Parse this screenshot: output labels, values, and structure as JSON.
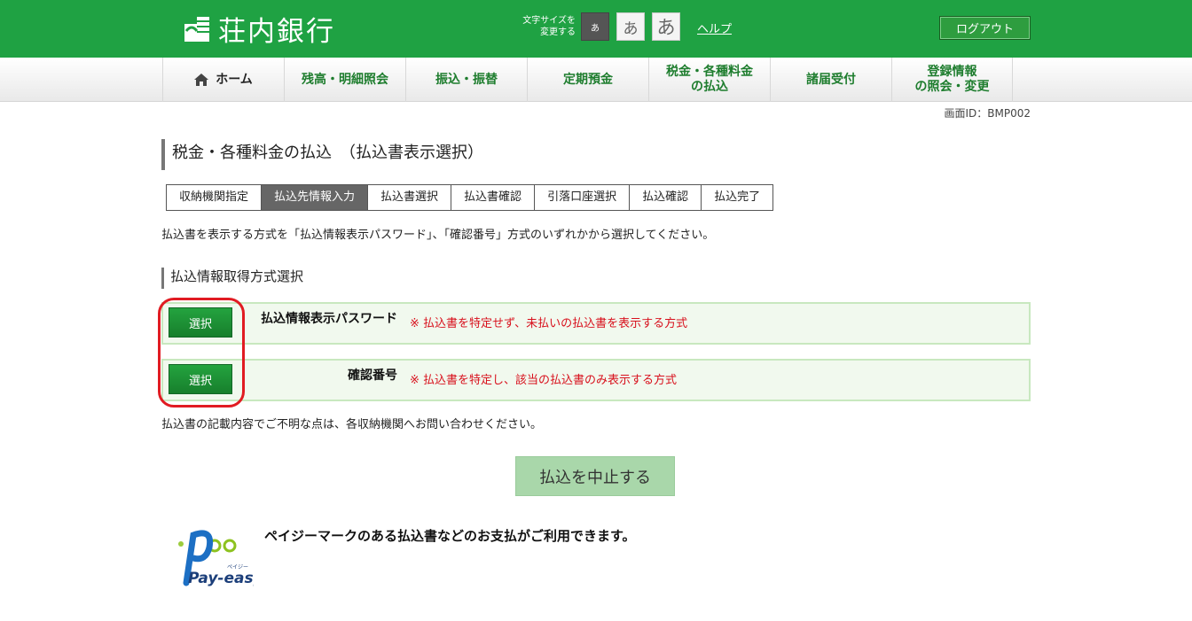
{
  "header": {
    "bank_name": "荘内銀行",
    "font_size_label_line1": "文字サイズを",
    "font_size_label_line2": "変更する",
    "font_size_small": "あ",
    "font_size_medium": "あ",
    "font_size_large": "あ",
    "help_label": "ヘルプ",
    "logout_label": "ログアウト",
    "colors": {
      "brand_green": "#1fa243"
    }
  },
  "nav": {
    "items": [
      {
        "label": "ホーム",
        "icon": "home-icon"
      },
      {
        "label": "残高・明細照会"
      },
      {
        "label": "振込・振替"
      },
      {
        "label": "定期預金"
      },
      {
        "label_line1": "税金・各種料金",
        "label_line2": "の払込"
      },
      {
        "label": "諸届受付"
      },
      {
        "label_line1": "登録情報",
        "label_line2": "の照会・変更"
      }
    ]
  },
  "screen_id": "画面ID：BMP002",
  "page_title": "税金・各種料金の払込　（払込書表示選択）",
  "steps": [
    {
      "label": "収納機関指定",
      "active": false
    },
    {
      "label": "払込先情報入力",
      "active": true
    },
    {
      "label": "払込書選択",
      "active": false
    },
    {
      "label": "払込書確認",
      "active": false
    },
    {
      "label": "引落口座選択",
      "active": false
    },
    {
      "label": "払込確認",
      "active": false
    },
    {
      "label": "払込完了",
      "active": false
    }
  ],
  "instruction": "払込書を表示する方式を「払込情報表示パスワード」、「確認番号」方式のいずれかから選択してください。",
  "section_title": "払込情報取得方式選択",
  "options": [
    {
      "button_label": "選択",
      "label": "払込情報表示パスワード",
      "note": "※ 払込書を特定せず、未払いの払込書を表示する方式"
    },
    {
      "button_label": "選択",
      "label": "確認番号",
      "note": "※ 払込書を特定し、該当の払込書のみ表示する方式"
    }
  ],
  "notice": "払込書の記載内容でご不明な点は、各収納機関へお問い合わせください。",
  "cancel_label": "払込を中止する",
  "payeasy": {
    "logo_text": "Pay-easy",
    "logo_kana": "ペイジー",
    "message": "ペイジーマークのある払込書などのお支払がご利用できます。"
  }
}
